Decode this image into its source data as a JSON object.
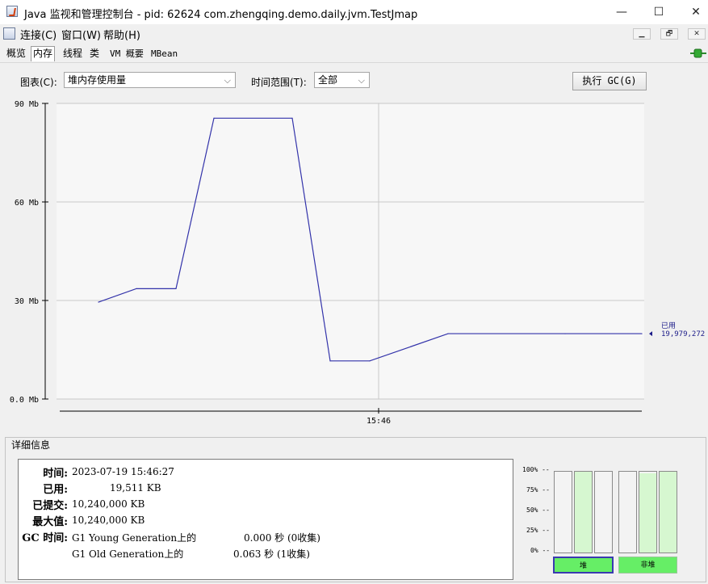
{
  "window": {
    "title": "Java 监视和管理控制台 - pid: 62624 com.zhengqing.demo.daily.jvm.TestJmap",
    "minimize_glyph": "—",
    "maximize_glyph": "☐",
    "close_glyph": "✕"
  },
  "menu": {
    "items": [
      "连接(C)",
      "窗口(W)",
      "帮助(H)"
    ],
    "mdi": [
      "▁",
      "🗗",
      "✕"
    ]
  },
  "tabs": [
    "概览",
    "内存",
    "线程",
    "类",
    "VM 概要",
    "MBean"
  ],
  "selected_tab": "内存",
  "controls": {
    "chart_label": "图表(C):",
    "chart_value": "堆内存使用量",
    "range_label": "时间范围(T):",
    "range_value": "全部",
    "gc_button": "执行 GC(G)"
  },
  "chart_data": {
    "type": "line",
    "y_unit": "Mb",
    "ylim": [
      0,
      90
    ],
    "yticks": [
      "0.0 Mb",
      "30 Mb",
      "60 Mb",
      "90 Mb"
    ],
    "xtick": "15:46",
    "series": [
      {
        "name": "已用",
        "color": "#3333aa",
        "values": [
          29.5,
          33.6,
          33.6,
          85.5,
          85.5,
          11.6,
          11.6,
          19.9,
          19.9,
          19.9
        ]
      }
    ],
    "current_label": "已用",
    "current_value": "19,979,272"
  },
  "details": {
    "title": "详细信息",
    "rows": [
      {
        "label": "时间:",
        "value": "2023-07-19 15:46:27"
      },
      {
        "label": "已用:",
        "value": "19,511 KB"
      },
      {
        "label": "已提交:",
        "value": "10,240,000 KB"
      },
      {
        "label": "最大值:",
        "value": "10,240,000 KB"
      },
      {
        "label": "GC 时间:",
        "value": "G1 Young Generation上的"
      }
    ],
    "gc_young_time": "0.000 秒 (0收集)",
    "gc_old_name": "G1 Old Generation上的",
    "gc_old_time": "0.063 秒 (1收集)"
  },
  "bars": {
    "pct_labels": [
      "100% --",
      "75% --",
      "50% --",
      "25% --",
      "0% --"
    ],
    "heap_fills": [
      0,
      1.0,
      0
    ],
    "nonheap_fills": [
      0,
      0.98,
      1.0
    ],
    "heap_label": "堆",
    "nonheap_label": "非堆",
    "fill_color": "#d6f7d0",
    "button_color": "#66ee66"
  }
}
